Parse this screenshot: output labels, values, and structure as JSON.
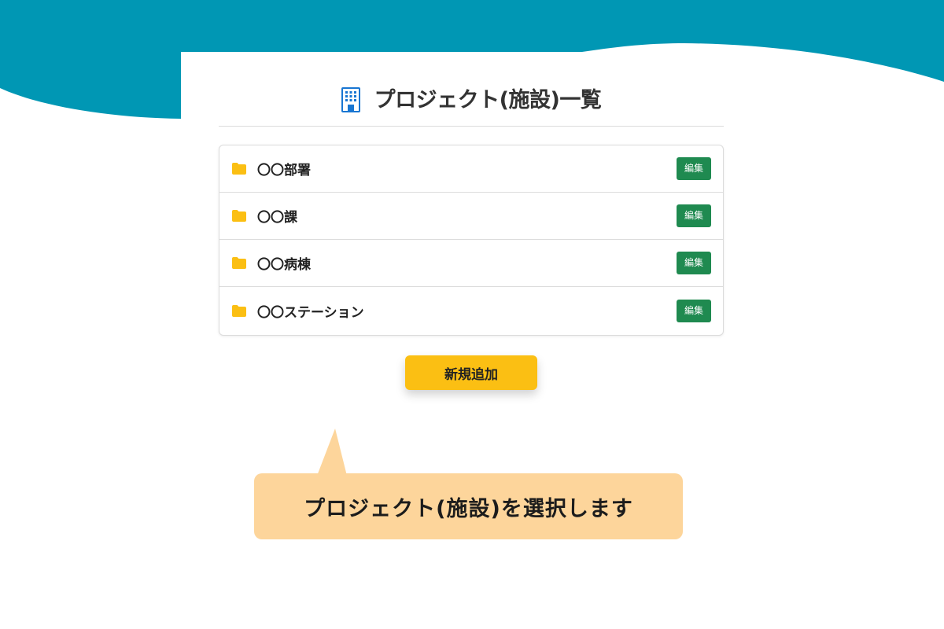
{
  "colors": {
    "header_band": "#0097b4",
    "edit_button": "#1f8a50",
    "add_button": "#fbbf13",
    "folder_icon": "#fbbf13",
    "building_icon": "#1976d2",
    "callout": "#fdd59b"
  },
  "header": {
    "icon": "building-icon",
    "title": "プロジェクト(施設)一覧"
  },
  "projects": [
    {
      "icon": "folder-icon",
      "name": "〇〇部署",
      "edit_label": "編集"
    },
    {
      "icon": "folder-icon",
      "name": "〇〇課",
      "edit_label": "編集"
    },
    {
      "icon": "folder-icon",
      "name": "〇〇病棟",
      "edit_label": "編集"
    },
    {
      "icon": "folder-icon",
      "name": "〇〇ステーション",
      "edit_label": "編集"
    }
  ],
  "actions": {
    "add_label": "新規追加"
  },
  "callout": {
    "text": "プロジェクト(施設)を選択します"
  }
}
